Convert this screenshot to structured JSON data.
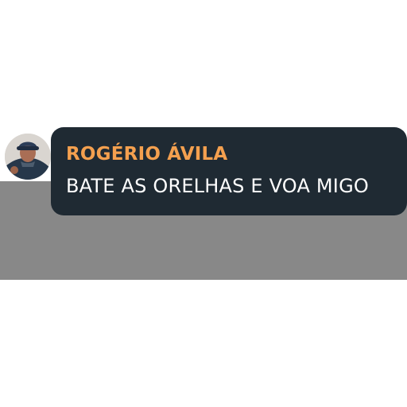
{
  "chat": {
    "sender_name": "ROGÉRIO ÁVILA",
    "message_text": "BATE AS ORELHAS E VOA MIGO"
  },
  "colors": {
    "bubble_background": "#1f2a33",
    "sender_name": "#f4a04f",
    "message_text": "#ffffff",
    "band_background": "#888888"
  },
  "icons": {
    "avatar": "user-avatar-photo"
  }
}
